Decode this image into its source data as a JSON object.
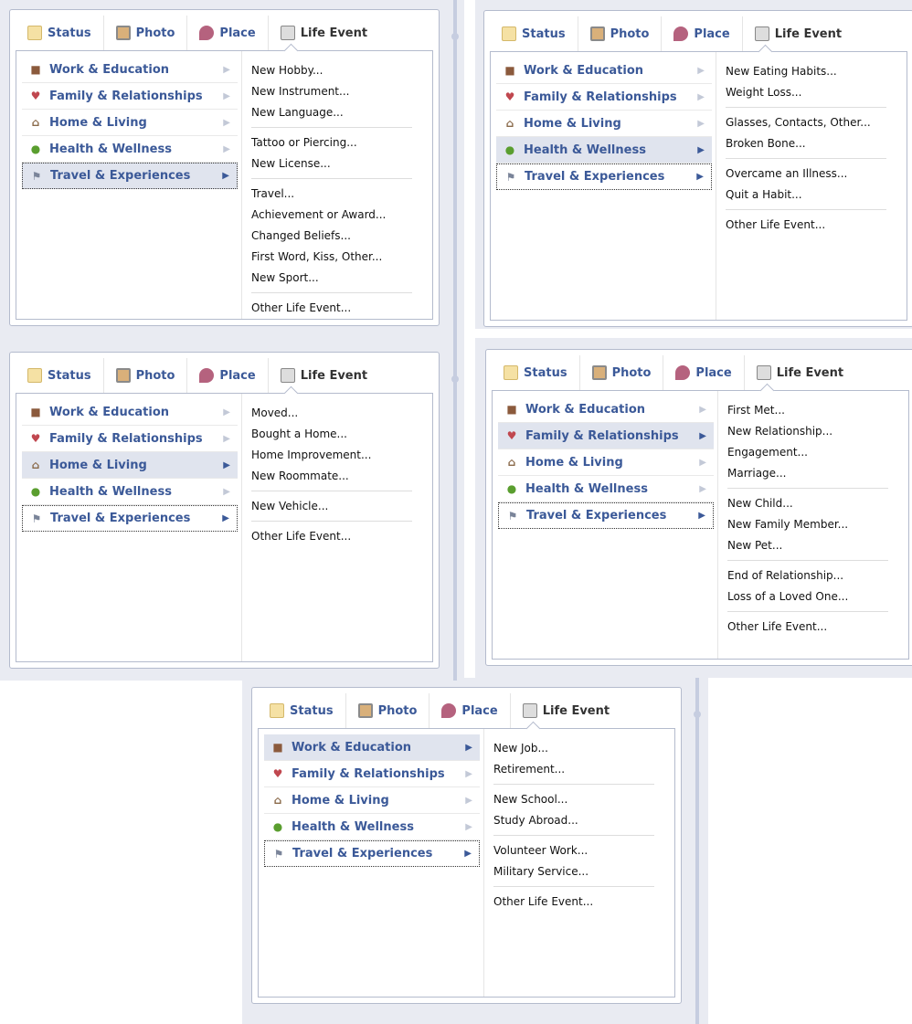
{
  "tabs": [
    {
      "label": "Status",
      "icon": "status-icon"
    },
    {
      "label": "Photo",
      "icon": "photo-icon"
    },
    {
      "label": "Place",
      "icon": "place-icon"
    },
    {
      "label": "Life Event",
      "icon": "life-event-icon"
    }
  ],
  "categories": [
    {
      "label": "Work & Education",
      "icon": "briefcase-icon"
    },
    {
      "label": "Family & Relationships",
      "icon": "heart-icon"
    },
    {
      "label": "Home & Living",
      "icon": "house-icon"
    },
    {
      "label": "Health & Wellness",
      "icon": "apple-icon"
    },
    {
      "label": "Travel & Experiences",
      "icon": "flag-icon"
    }
  ],
  "panels": [
    {
      "selected": 4,
      "groups": [
        [
          "New Hobby...",
          "New Instrument...",
          "New Language..."
        ],
        [
          "Tattoo or Piercing...",
          "New License..."
        ],
        [
          "Travel...",
          "Achievement or Award...",
          "Changed Beliefs...",
          "First Word, Kiss, Other...",
          "New Sport..."
        ],
        [
          "Other Life Event..."
        ]
      ]
    },
    {
      "selected": 3,
      "groups": [
        [
          "New Eating Habits...",
          "Weight Loss..."
        ],
        [
          "Glasses, Contacts, Other...",
          "Broken Bone..."
        ],
        [
          "Overcame an Illness...",
          "Quit a Habit..."
        ],
        [
          "Other Life Event..."
        ]
      ]
    },
    {
      "selected": 2,
      "groups": [
        [
          "Moved...",
          "Bought a Home...",
          "Home Improvement...",
          "New Roommate..."
        ],
        [
          "New Vehicle..."
        ],
        [
          "Other Life Event..."
        ]
      ]
    },
    {
      "selected": 1,
      "groups": [
        [
          "First Met...",
          "New Relationship...",
          "Engagement...",
          "Marriage..."
        ],
        [
          "New Child...",
          "New Family Member...",
          "New Pet..."
        ],
        [
          "End of Relationship...",
          "Loss of a Loved One..."
        ],
        [
          "Other Life Event..."
        ]
      ]
    },
    {
      "selected": 0,
      "groups": [
        [
          "New Job...",
          "Retirement..."
        ],
        [
          "New School...",
          "Study Abroad..."
        ],
        [
          "Volunteer Work...",
          "Military Service..."
        ],
        [
          "Other Life Event..."
        ]
      ]
    }
  ]
}
